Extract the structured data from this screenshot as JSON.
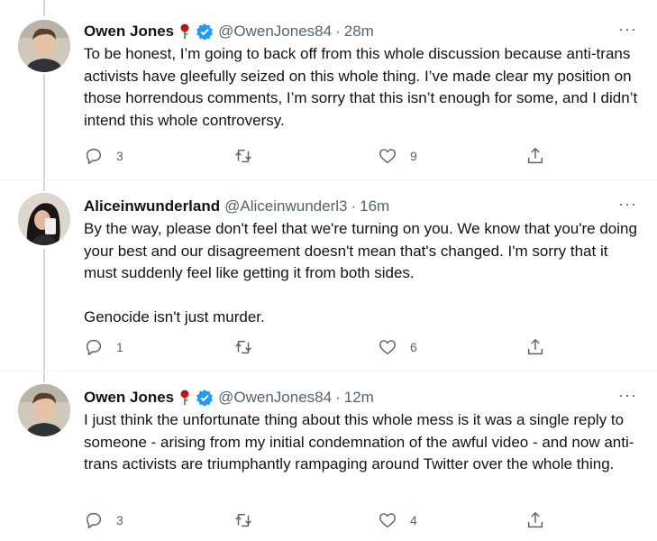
{
  "tweets": [
    {
      "name": "Owen Jones",
      "has_rose": true,
      "verified": true,
      "handle": "@OwenJones84",
      "time": "28m",
      "paragraphs": [
        "To be honest, I’m going to back off from this whole discussion because anti-trans activists have gleefully seized on this whole thing. I’ve made clear my position on those horrendous comments, I’m sorry that this isn’t enough for some, and I didn’t intend this whole controversy."
      ],
      "replies": "3",
      "retweets": "",
      "likes": "9"
    },
    {
      "name": "Aliceinwunderland",
      "has_rose": false,
      "verified": false,
      "handle": "@Aliceinwunderl3",
      "time": "16m",
      "paragraphs": [
        "By the way, please don't feel that we're turning on you. We know that you're doing your best and our disagreement doesn't mean that's changed. I'm sorry that it must suddenly feel like getting it from both sides.",
        "Genocide isn't just murder."
      ],
      "replies": "1",
      "retweets": "",
      "likes": "6"
    },
    {
      "name": "Owen Jones",
      "has_rose": true,
      "verified": true,
      "handle": "@OwenJones84",
      "time": "12m",
      "paragraphs": [
        "I just think the unfortunate thing about this whole mess is it was a single reply to someone - arising from my initial condemnation of the awful video - and now anti-trans activists are triumphantly rampaging around Twitter over the whole thing."
      ],
      "replies": "3",
      "retweets": "",
      "likes": "4"
    }
  ],
  "separator": "·",
  "more_glyph": "···",
  "colors": {
    "text": "#0f1419",
    "secondary": "#536471",
    "verified": "#1d9bf0",
    "rose": "#c4161c"
  }
}
